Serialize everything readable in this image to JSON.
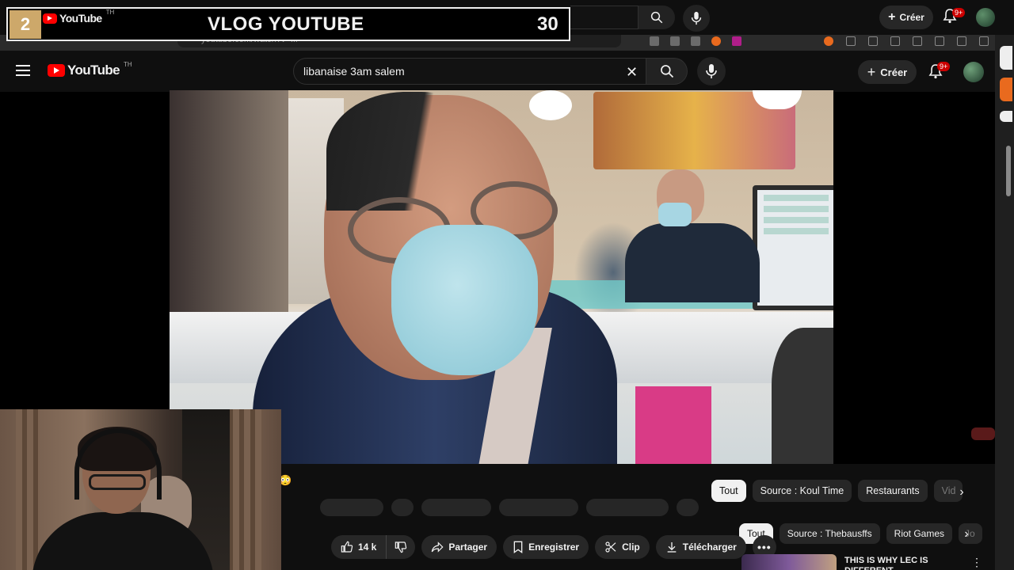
{
  "echo_header": {
    "create_label": "Créer",
    "notification_count": "9+"
  },
  "browser": {
    "url": "youtube.com/watch?v=...",
    "icons": [
      "translate-icon",
      "tab-icon",
      "share-icon",
      "brave-icon",
      "aria-icon",
      "extension-icon",
      "bookmark-icon",
      "split-icon",
      "profile-icon"
    ]
  },
  "header": {
    "logo_text": "YouTube",
    "logo_region": "TH",
    "search_value": "libanaise 3am salem",
    "create_label": "Créer",
    "notification_count": "9+"
  },
  "overlay": {
    "badge_number": "2",
    "logo_text": "YouTube",
    "logo_region": "TH",
    "title": "VLOG YOUTUBE",
    "count": "30"
  },
  "chips_top": [
    {
      "label": "Tout",
      "active": true
    },
    {
      "label": "Source : Koul Time",
      "active": false
    },
    {
      "label": "Restaurants",
      "active": false
    },
    {
      "label": "Vid",
      "active": false
    }
  ],
  "chips_bottom": [
    {
      "label": "Tout",
      "active": true
    },
    {
      "label": "Source : Thebausffs",
      "active": false
    },
    {
      "label": "Riot Games",
      "active": false
    },
    {
      "label": "Jo",
      "active": false
    }
  ],
  "actions": {
    "like_count": "14 k",
    "share_label": "Partager",
    "save_label": "Enregistrer",
    "clip_label": "Clip",
    "download_label": "Télécharger"
  },
  "recommendation": {
    "title": "THIS IS WHY LEC IS DIFFERENT"
  },
  "colors": {
    "background": "#0f0f0f",
    "brand_red": "#ff0000",
    "badge_red": "#cc0000",
    "banner_gold": "#cda86a"
  }
}
